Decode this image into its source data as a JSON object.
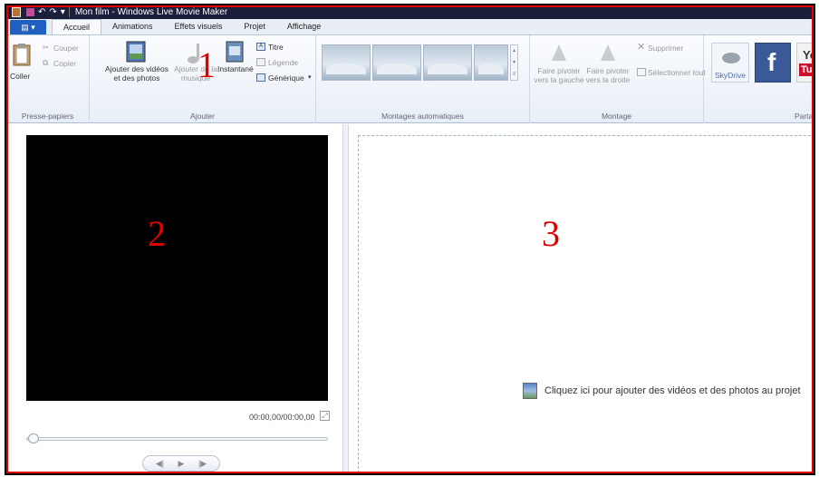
{
  "window": {
    "title": "Mon film - Windows Live Movie Maker"
  },
  "tabs": [
    {
      "label": "Accueil",
      "active": true
    },
    {
      "label": "Animations"
    },
    {
      "label": "Effets visuels"
    },
    {
      "label": "Projet"
    },
    {
      "label": "Affichage"
    }
  ],
  "ribbon": {
    "clipboard": {
      "label": "Presse-papiers",
      "paste": "Coller",
      "cut": "Couper",
      "copy": "Copier"
    },
    "add": {
      "label": "Ajouter",
      "add_videos_line1": "Ajouter des vidéos",
      "add_videos_line2": "et des photos",
      "add_music_line1": "Ajouter de la",
      "add_music_line2": "musique",
      "snapshot": "Instantané",
      "title": "Titre",
      "caption": "Légende",
      "credits": "Générique"
    },
    "automovie": {
      "label": "Montages automatiques"
    },
    "editing": {
      "label": "Montage",
      "rotate_left_line1": "Faire pivoter",
      "rotate_left_line2": "vers la gauche",
      "rotate_right_line1": "Faire pivoter",
      "rotate_right_line2": "vers la droite",
      "delete": "Supprimer",
      "select_all": "Sélectionner tout"
    },
    "share": {
      "label": "Partag",
      "skydrive": "SkyDrive",
      "youtube_line1": "You",
      "youtube_line2": "Tube"
    }
  },
  "annotations": {
    "one": "1",
    "two": "2",
    "three": "3"
  },
  "player": {
    "timecode": "00:00,00/00:00,00"
  },
  "storyboard": {
    "hint": "Cliquez ici pour ajouter des vidéos et des photos au projet"
  },
  "colors": {
    "annotation": "#e00000",
    "titlebar": "#1b1f3a",
    "file_button": "#1e5fbf"
  }
}
